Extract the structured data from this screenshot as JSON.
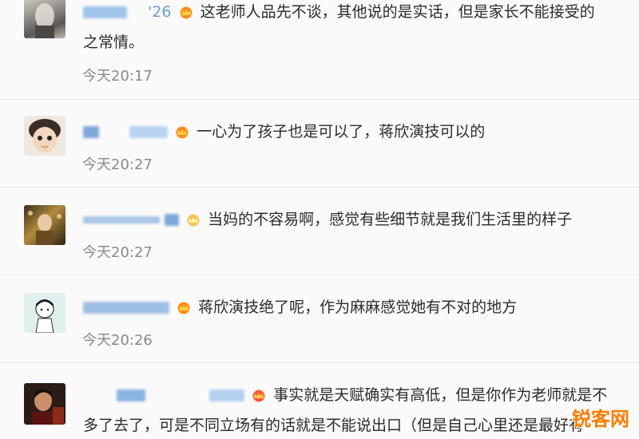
{
  "comments": [
    {
      "username_suffix": "'26",
      "text": "这老师人品先不谈，其他说的是实话，但是家长不能接受的",
      "text_continued": "之常情。",
      "time": "今天20:17"
    },
    {
      "text": "一心为了孩子也是可以了，蒋欣演技可以的",
      "time": "今天20:27"
    },
    {
      "text": "当妈的不容易啊，感觉有些细节就是我们生活里的样子",
      "time": "今天20:27"
    },
    {
      "text": "蒋欣演技绝了呢，作为麻麻感觉她有不对的地方",
      "time": "今天20:26"
    },
    {
      "text": "事实就是天赋确实有高低，但是你作为老师就是不",
      "text_continued": "多了去了，可是不同立场有的话就是不能说出口（但是自己心里还是最好有"
    }
  ],
  "watermark": "锐客网",
  "icons": {
    "vip": "crown-icon"
  }
}
